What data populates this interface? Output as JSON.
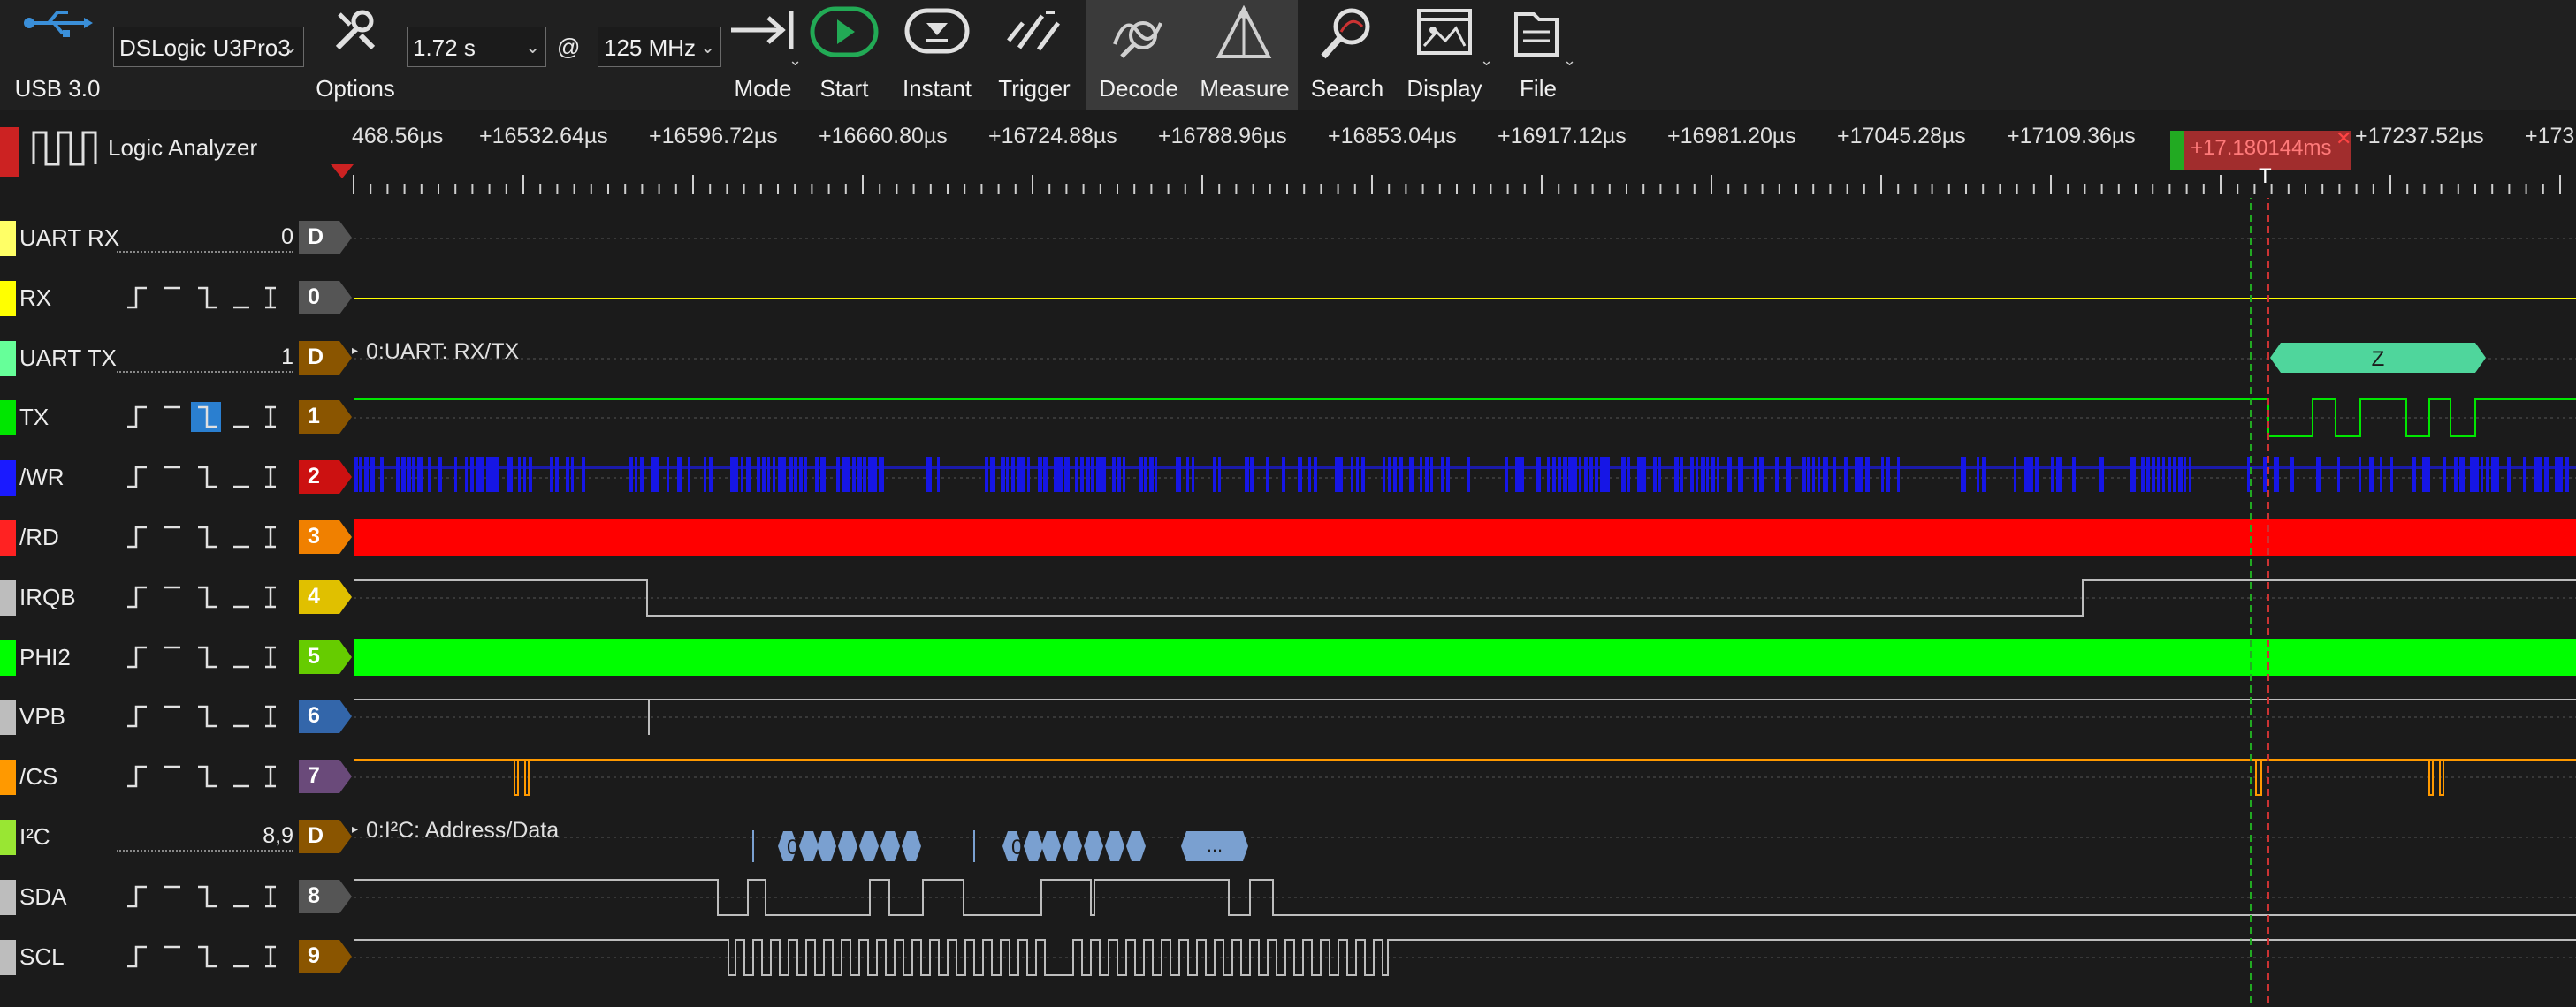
{
  "toolbar": {
    "usb_label": "USB 3.0",
    "device": "DSLogic U3Pro3",
    "options_label": "Options",
    "duration": "1.72 s",
    "at": "@",
    "rate": "125 MHz",
    "mode_label": "Mode",
    "start_label": "Start",
    "instant_label": "Instant",
    "trigger_label": "Trigger",
    "decode_label": "Decode",
    "measure_label": "Measure",
    "search_label": "Search",
    "display_label": "Display",
    "file_label": "File"
  },
  "panel": {
    "title": "Logic Analyzer"
  },
  "ruler": {
    "labels": [
      "468.56µs",
      "+16532.64µs",
      "+16596.72µs",
      "+16660.80µs",
      "+16724.88µs",
      "+16788.96µs",
      "+16853.04µs",
      "+16917.12µs",
      "+16981.20µs",
      "+17045.28µs",
      "+17109.36µs",
      "+17237.52µs",
      "+173"
    ],
    "cursor_value": "+17.180144ms",
    "trigger_marker": "T"
  },
  "channels": [
    {
      "name": "UART RX",
      "badge": "D",
      "value": "0",
      "color": "#ffff66",
      "badge_color": "#555555",
      "kind": "decoder"
    },
    {
      "name": "RX",
      "badge": "0",
      "color": "#ffff00",
      "badge_color": "#555555",
      "kind": "logic"
    },
    {
      "name": "UART TX",
      "badge": "D",
      "value": "1",
      "color": "#66ff99",
      "badge_color": "#8a5500",
      "kind": "decoder",
      "decoder_title": "0:UART: RX/TX",
      "decoded": "Z"
    },
    {
      "name": "TX",
      "badge": "1",
      "color": "#00e600",
      "badge_color": "#8a5500",
      "kind": "logic"
    },
    {
      "name": "/WR",
      "badge": "2",
      "color": "#1a1aff",
      "badge_color": "#cc1111",
      "kind": "logic"
    },
    {
      "name": "/RD",
      "badge": "3",
      "color": "#ff2222",
      "badge_color": "#f08000",
      "kind": "logic"
    },
    {
      "name": "IRQB",
      "badge": "4",
      "color": "#bdbdbd",
      "badge_color": "#e0c000",
      "kind": "logic"
    },
    {
      "name": "PHI2",
      "badge": "5",
      "color": "#00ff00",
      "badge_color": "#66cc00",
      "kind": "logic"
    },
    {
      "name": "VPB",
      "badge": "6",
      "color": "#bdbdbd",
      "badge_color": "#3366aa",
      "kind": "logic"
    },
    {
      "name": "/CS",
      "badge": "7",
      "color": "#ff9900",
      "badge_color": "#6a4a7a",
      "kind": "logic"
    },
    {
      "name": "I²C",
      "badge": "D",
      "value": "8,9",
      "color": "#99e633",
      "badge_color": "#8a5500",
      "kind": "decoder",
      "decoder_title": "0:I²C: Address/Data",
      "i2c_first": "0",
      "i2c_more": "..."
    },
    {
      "name": "SDA",
      "badge": "8",
      "color": "#bdbdbd",
      "badge_color": "#555555",
      "kind": "logic"
    },
    {
      "name": "SCL",
      "badge": "9",
      "color": "#bdbdbd",
      "badge_color": "#8a5500",
      "kind": "logic"
    }
  ],
  "colors": {
    "background": "#1b1b1b",
    "toolbar": "#202020",
    "accent_green": "#22aa55",
    "cursor_red": "#b83030",
    "uart_decode": "#4fd69c",
    "i2c_decode": "#7aa0d0"
  },
  "icons": [
    "usb-icon",
    "options-wrench-icon",
    "mode-icon",
    "start-play-icon",
    "instant-icon",
    "trigger-icon",
    "decode-icon",
    "measure-icon",
    "search-icon",
    "display-icon",
    "file-icon",
    "square-wave-icon"
  ]
}
